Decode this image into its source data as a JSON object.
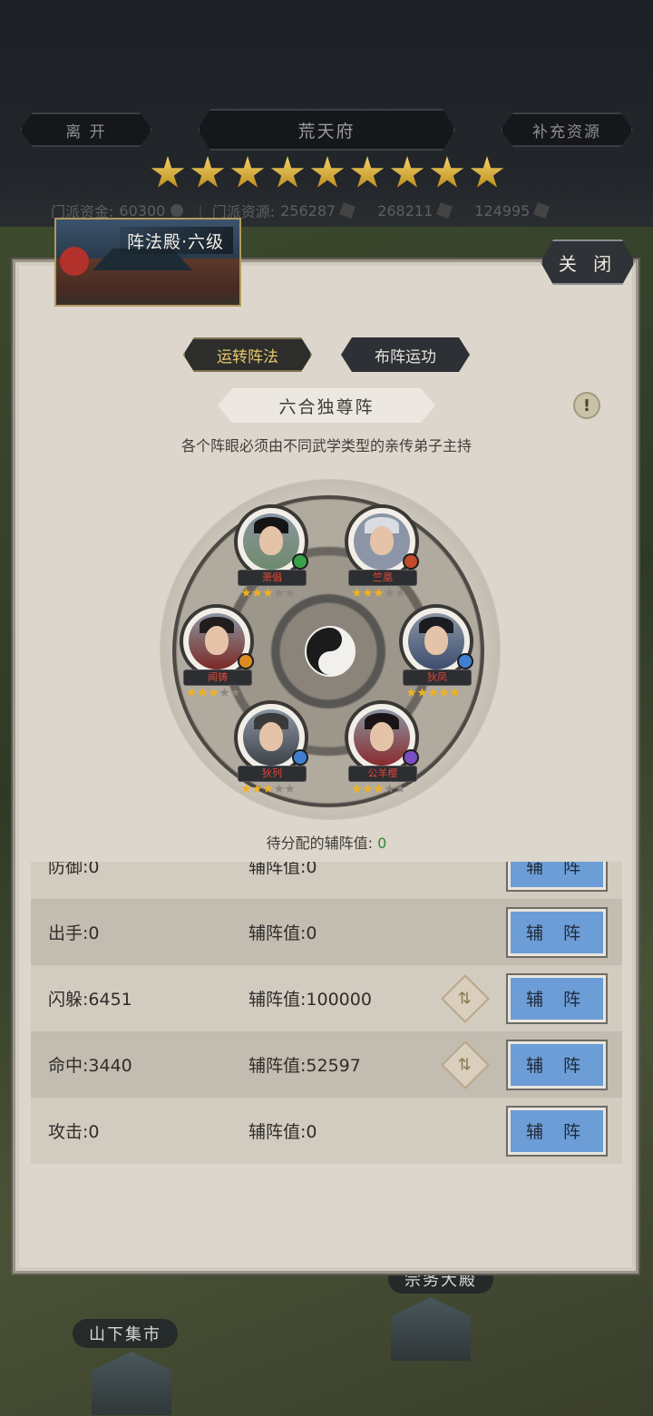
{
  "top": {
    "leave_label": "离 开",
    "location_title": "荒天府",
    "supply_label": "补充资源",
    "star_count": 9,
    "sect_funds_label": "门派资金:",
    "sect_funds_value": "60300",
    "sect_resources_label": "门派资源:",
    "resource_1": "256287",
    "resource_2": "268211",
    "resource_3": "124995"
  },
  "building": {
    "title": "阵法殿·六级",
    "close_label": "关 闭"
  },
  "tabs": {
    "active": "运转阵法",
    "inactive": "布阵运功"
  },
  "formation": {
    "name": "六合独尊阵",
    "info_glyph": "!",
    "hint": "各个阵眼必须由不同武学类型的亲传弟子主持",
    "disciples": [
      {
        "name": "萧倡",
        "stars": 3,
        "badge_color": "#3aa04a",
        "hair": "#151515",
        "robe": "#6f8a6a"
      },
      {
        "name": "竺凰",
        "stars": 3,
        "badge_color": "#c24b2b",
        "hair": "#d9dce3",
        "robe": "#8c95a8"
      },
      {
        "name": "闻铸",
        "stars": 3,
        "badge_color": "#e08a23",
        "hair": "#201d1c",
        "robe": "#7b2a25"
      },
      {
        "name": "狄凤",
        "stars": 5,
        "badge_color": "#3f7fd1",
        "hair": "#1b1c22",
        "robe": "#3d4e70"
      },
      {
        "name": "狄列",
        "stars": 3,
        "badge_color": "#3f7fd1",
        "hair": "#3a3a3a",
        "robe": "#3e4248"
      },
      {
        "name": "公羊樱",
        "stars": 3,
        "badge_color": "#7a4fc4",
        "hair": "#1a1416",
        "robe": "#8a2a2e"
      }
    ],
    "max_stars": 5,
    "pending_label": "待分配的辅阵值:",
    "pending_value": "0"
  },
  "rows": [
    {
      "stat_label": "防御:",
      "stat_value": "0",
      "aux_label": "辅阵值:",
      "aux_value": "0",
      "has_swap": false,
      "assist_label": "辅 阵"
    },
    {
      "stat_label": "出手:",
      "stat_value": "0",
      "aux_label": "辅阵值:",
      "aux_value": "0",
      "has_swap": false,
      "assist_label": "辅 阵"
    },
    {
      "stat_label": "闪躲:",
      "stat_value": "6451",
      "aux_label": "辅阵值:",
      "aux_value": "100000",
      "has_swap": true,
      "assist_label": "辅 阵"
    },
    {
      "stat_label": "命中:",
      "stat_value": "3440",
      "aux_label": "辅阵值:",
      "aux_value": "52597",
      "has_swap": true,
      "assist_label": "辅 阵"
    },
    {
      "stat_label": "攻击:",
      "stat_value": "0",
      "aux_label": "辅阵值:",
      "aux_value": "0",
      "has_swap": false,
      "assist_label": "辅 阵"
    }
  ],
  "map": {
    "market_label": "山下集市",
    "hall_label": "宗务大殿"
  },
  "icons": {
    "swap_icon": "exchange-icon",
    "coin_icon": "coin-icon"
  }
}
